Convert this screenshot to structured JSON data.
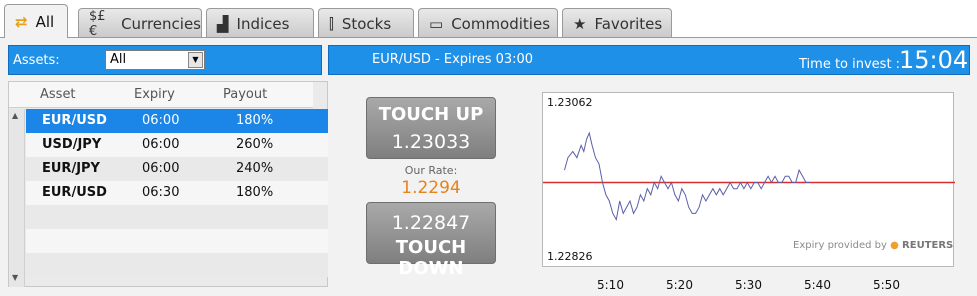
{
  "tabs": [
    {
      "label": "All",
      "icon": "refresh-arrows-icon",
      "active": true
    },
    {
      "label": "Currencies",
      "icon": "currency-symbols-icon",
      "active": false
    },
    {
      "label": "Indices",
      "icon": "bar-trend-icon",
      "active": false
    },
    {
      "label": "Stocks",
      "icon": "stock-chart-icon",
      "active": false
    },
    {
      "label": "Commodities",
      "icon": "gold-bar-icon",
      "active": false
    },
    {
      "label": "Favorites",
      "icon": "star-icon",
      "active": false
    }
  ],
  "filter": {
    "label": "Assets:",
    "selected": "All"
  },
  "table": {
    "headers": [
      "Asset",
      "Expiry",
      "Payout"
    ],
    "rows": [
      {
        "asset": "EUR/USD",
        "expiry": "06:00",
        "payout": "180%",
        "selected": true
      },
      {
        "asset": "USD/JPY",
        "expiry": "06:00",
        "payout": "260%",
        "selected": false
      },
      {
        "asset": "EUR/JPY",
        "expiry": "06:00",
        "payout": "240%",
        "selected": false
      },
      {
        "asset": "EUR/USD",
        "expiry": "06:30",
        "payout": "180%",
        "selected": false
      }
    ]
  },
  "trade": {
    "title": "EUR/USD - Expires 03:00",
    "time_label": "Time to invest :",
    "time_value": "15:04",
    "touch_up_label": "TOUCH UP",
    "touch_up_value": "1.23033",
    "rate_label": "Our Rate:",
    "rate_value": "1.2294",
    "touch_down_value": "1.22847",
    "touch_down_label": "TOUCH DOWN",
    "accent_color": "#1e90e8",
    "rate_color": "#e8821a"
  },
  "chart_data": {
    "type": "line",
    "ylabel_high": "1.23062",
    "ylabel_low": "1.22826",
    "ylim": [
      1.22826,
      1.23062
    ],
    "reference_line": 1.2294,
    "xticks": [
      "5:10",
      "5:20",
      "5:30",
      "5:40",
      "5:50"
    ],
    "x_minutes": [
      5.0,
      5.5,
      6.2,
      6.8,
      7.4,
      7.8,
      8.2,
      8.6,
      9.0,
      9.5,
      10.0,
      10.5,
      11.0,
      11.5,
      12.0,
      12.5,
      13.0,
      13.5,
      14.0,
      14.5,
      15.0,
      15.5,
      16.0,
      16.5,
      17.0,
      17.5,
      18.0,
      18.5,
      19.0,
      19.5,
      20.0,
      20.5,
      21.0,
      21.5,
      22.0,
      22.5,
      23.0,
      23.5,
      24.0,
      24.5,
      25.0,
      25.5,
      26.0,
      26.5,
      27.0,
      27.5,
      28.0,
      28.5,
      29.0,
      29.5,
      30.0,
      30.5,
      31.0,
      31.5,
      32.0,
      32.5,
      33.0,
      33.5,
      34.0,
      34.5,
      35.0,
      35.5,
      36.0,
      36.5,
      37.0,
      37.5,
      38.0,
      38.5,
      39.0,
      39.5,
      40.0,
      40.5
    ],
    "y": [
      1.2296,
      1.2298,
      1.2299,
      1.2298,
      1.23,
      1.2299,
      1.2301,
      1.2302,
      1.23,
      1.2298,
      1.2297,
      1.2294,
      1.2292,
      1.2291,
      1.2289,
      1.2288,
      1.2291,
      1.2289,
      1.229,
      1.2291,
      1.2289,
      1.229,
      1.2292,
      1.2291,
      1.2293,
      1.2292,
      1.2294,
      1.2293,
      1.2295,
      1.2294,
      1.2293,
      1.2294,
      1.2292,
      1.2291,
      1.2293,
      1.2292,
      1.229,
      1.2289,
      1.2289,
      1.229,
      1.2292,
      1.2291,
      1.2292,
      1.2293,
      1.2292,
      1.2293,
      1.2292,
      1.2293,
      1.2294,
      1.2293,
      1.2293,
      1.2294,
      1.2293,
      1.2294,
      1.2293,
      1.2294,
      1.2294,
      1.2293,
      1.2294,
      1.2295,
      1.2294,
      1.2295,
      1.2294,
      1.2294,
      1.2295,
      1.2295,
      1.2294,
      1.2294,
      1.2296,
      1.2295,
      1.2294,
      1.2294
    ],
    "line_color": "#5b5fa8",
    "reference_color": "#d62f2f",
    "attribution": "Expiry provided by",
    "attribution_brand": "REUTERS"
  }
}
